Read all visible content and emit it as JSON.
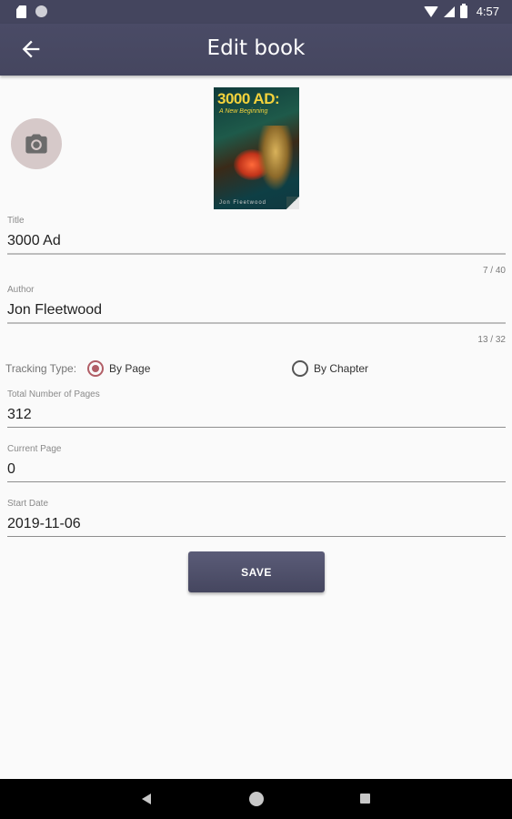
{
  "status_bar": {
    "time": "4:57"
  },
  "app_bar": {
    "title": "Edit book"
  },
  "cover": {
    "title": "3000 AD:",
    "subtitle": "A New Beginning",
    "author": "Jon Fleetwood"
  },
  "fields": {
    "title": {
      "label": "Title",
      "value": "3000 Ad",
      "counter": "7 / 40"
    },
    "author": {
      "label": "Author",
      "value": "Jon Fleetwood",
      "counter": "13 / 32"
    },
    "total_pages": {
      "label": "Total Number of Pages",
      "value": "312"
    },
    "current_page": {
      "label": "Current Page",
      "value": "0"
    },
    "start_date": {
      "label": "Start Date",
      "value": "2019-11-06"
    }
  },
  "tracking": {
    "label": "Tracking Type:",
    "options": [
      {
        "label": "By Page",
        "checked": true
      },
      {
        "label": "By Chapter",
        "checked": false
      }
    ]
  },
  "save_label": "SAVE",
  "colors": {
    "primary": "#45465f",
    "accent": "#b15e66"
  }
}
